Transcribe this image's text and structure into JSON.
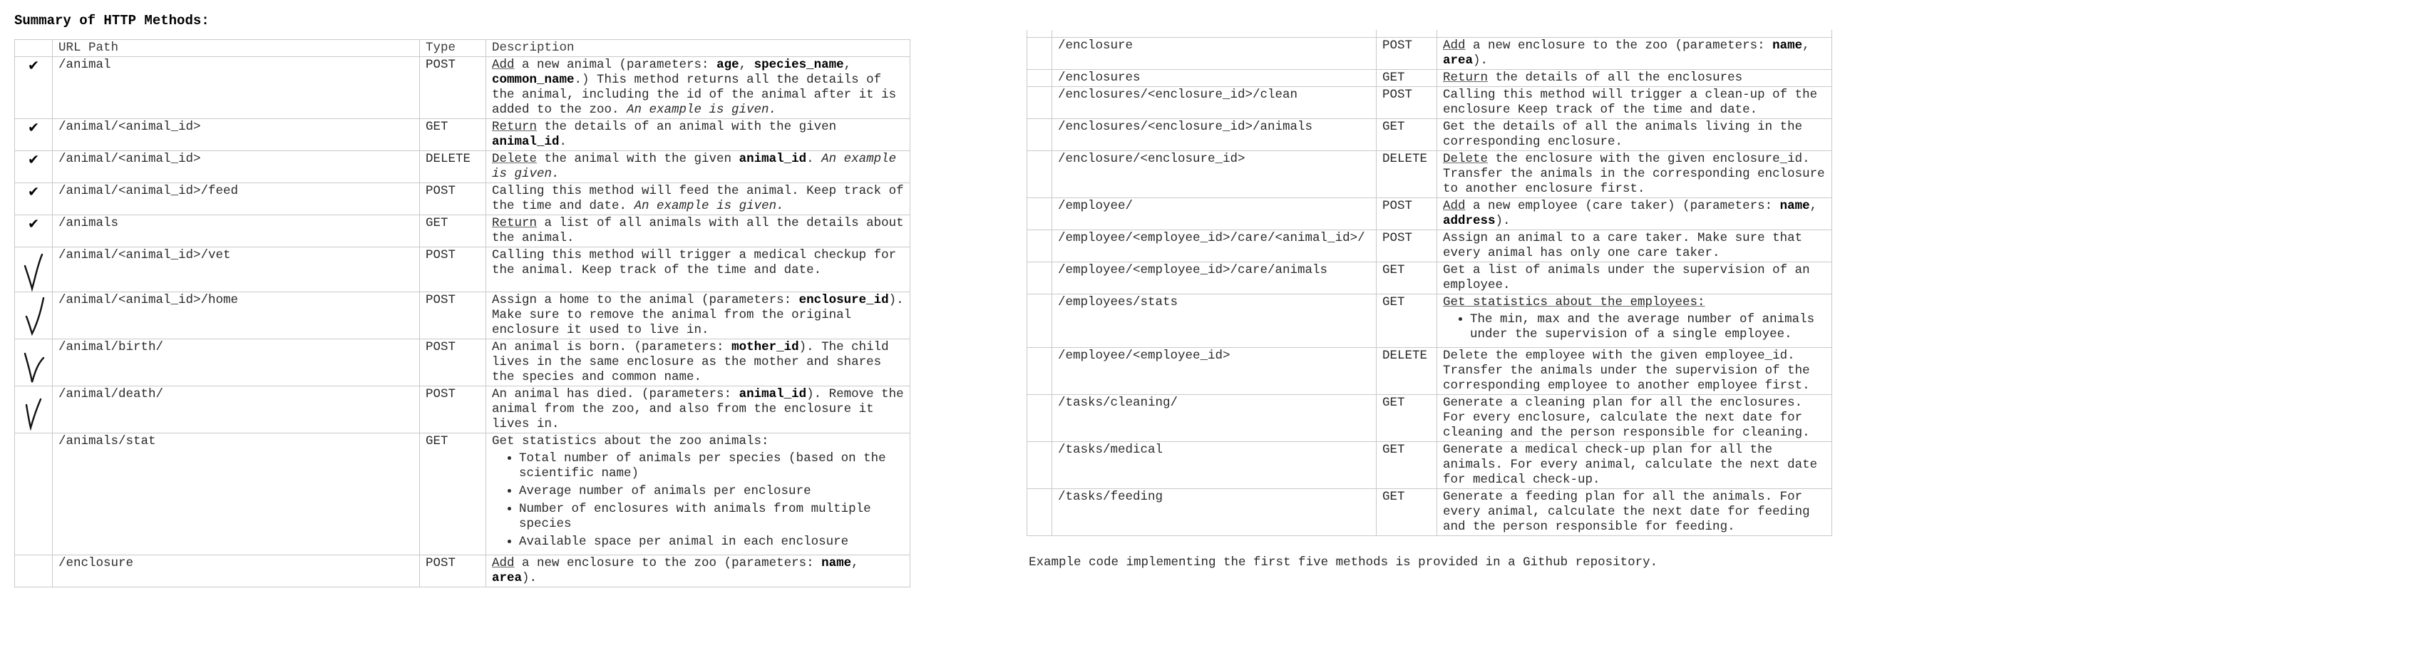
{
  "heading": "Summary of HTTP Methods:",
  "columns": {
    "url": "URL Path",
    "type": "Type",
    "description": "Description"
  },
  "left_rows": [
    {
      "url": "/animal",
      "type": "POST",
      "d": [
        {
          "t": "Add",
          "s": "u"
        },
        {
          "t": " a new animal (parameters: "
        },
        {
          "t": "age",
          "s": "b"
        },
        {
          "t": ", "
        },
        {
          "t": "species_name",
          "s": "b"
        },
        {
          "t": ", "
        },
        {
          "t": "common_name",
          "s": "b"
        },
        {
          "t": ".) This method returns all the details of the animal, including the id of the animal after it is added to the zoo. "
        },
        {
          "t": "An example is given.",
          "s": "i"
        }
      ]
    },
    {
      "url": "/animal/<animal_id>",
      "type": "GET",
      "d": [
        {
          "t": "Return",
          "s": "u"
        },
        {
          "t": " the details of an animal with the given "
        },
        {
          "t": "animal_id",
          "s": "b"
        },
        {
          "t": "."
        }
      ]
    },
    {
      "url": "/animal/<animal_id>",
      "type": "DELETE",
      "d": [
        {
          "t": "Delete",
          "s": "u"
        },
        {
          "t": " the animal with the given "
        },
        {
          "t": "animal_id",
          "s": "b"
        },
        {
          "t": ". "
        },
        {
          "t": "An example is given.",
          "s": "i"
        }
      ]
    },
    {
      "url": "/animal/<animal_id>/feed",
      "type": "POST",
      "d": [
        {
          "t": "Calling this method will feed the animal. Keep track of the time and date. "
        },
        {
          "t": "An example is given.",
          "s": "i"
        }
      ]
    },
    {
      "url": "/animals",
      "type": "GET",
      "d": [
        {
          "t": "Return",
          "s": "u"
        },
        {
          "t": " a list of all animals with all the details about the animal."
        }
      ]
    },
    {
      "url": "/animal/<animal_id>/vet",
      "type": "POST",
      "d": [
        {
          "t": "Calling this method will trigger a medical checkup for the animal. Keep track of the time and date."
        }
      ]
    },
    {
      "url": "/animal/<animal_id>/home",
      "type": "POST",
      "d": [
        {
          "t": "Assign a home to the animal (parameters: "
        },
        {
          "t": "enclosure_id",
          "s": "b"
        },
        {
          "t": "). Make sure to remove the animal from the original enclosure it used to live in."
        }
      ]
    },
    {
      "url": "/animal/birth/",
      "type": "POST",
      "d": [
        {
          "t": "An animal is born. (parameters: "
        },
        {
          "t": "mother_id",
          "s": "b"
        },
        {
          "t": "). The child lives in the same enclosure as the mother and shares the species and common name."
        }
      ]
    },
    {
      "url": "/animal/death/",
      "type": "POST",
      "d": [
        {
          "t": "An animal has died. (parameters: "
        },
        {
          "t": "animal_id",
          "s": "b"
        },
        {
          "t": "). Remove the animal from the zoo, and also from the enclosure it lives in."
        }
      ]
    },
    {
      "url": "/animals/stat",
      "type": "GET",
      "d": [
        {
          "t": "Get statistics about the zoo animals:"
        }
      ],
      "bullets": [
        "Total number of animals per species (based on the scientific name)",
        "Average number of animals per enclosure",
        "Number of enclosures with animals from multiple species",
        "Available space per animal in each enclosure"
      ]
    },
    {
      "url": "/enclosure",
      "type": "POST",
      "d": [
        {
          "t": "Add",
          "s": "u"
        },
        {
          "t": " a new enclosure to the zoo (parameters: "
        },
        {
          "t": "name",
          "s": "b"
        },
        {
          "t": ", "
        },
        {
          "t": "area",
          "s": "b"
        },
        {
          "t": ")."
        }
      ]
    }
  ],
  "marks": [
    "check",
    "check",
    "check",
    "check",
    "check",
    "hand",
    "hand",
    "hand",
    "hand",
    "",
    ""
  ],
  "right_rows": [
    {
      "url": "/enclosure",
      "type": "POST",
      "d": [
        {
          "t": "Add",
          "s": "u"
        },
        {
          "t": " a new enclosure to the zoo (parameters: "
        },
        {
          "t": "name",
          "s": "b"
        },
        {
          "t": ", "
        },
        {
          "t": "area",
          "s": "b"
        },
        {
          "t": ")."
        }
      ]
    },
    {
      "url": "/enclosures",
      "type": "GET",
      "d": [
        {
          "t": "Return",
          "s": "u"
        },
        {
          "t": " the details of all the enclosures"
        }
      ]
    },
    {
      "url": "/enclosures/<enclosure_id>/clean",
      "type": "POST",
      "d": [
        {
          "t": "Calling this method will trigger a clean-up of the enclosure Keep track of the time and date."
        }
      ]
    },
    {
      "url": "/enclosures/<enclosure_id>/animals",
      "type": "GET",
      "d": [
        {
          "t": "Get the details of all the animals living in the corresponding enclosure."
        }
      ]
    },
    {
      "url": "/enclosure/<enclosure_id>",
      "type": "DELETE",
      "d": [
        {
          "t": "Delete",
          "s": "u"
        },
        {
          "t": " the enclosure with the given enclosure_id. Transfer the animals in the corresponding enclosure to another enclosure first."
        }
      ]
    },
    {
      "url": "/employee/",
      "type": "POST",
      "d": [
        {
          "t": "Add",
          "s": "u"
        },
        {
          "t": " a new employee (care taker) (parameters: "
        },
        {
          "t": "name",
          "s": "b"
        },
        {
          "t": ", "
        },
        {
          "t": "address",
          "s": "b"
        },
        {
          "t": ")."
        }
      ]
    },
    {
      "url": "/employee/<employee_id>/care/<animal_id>/",
      "type": "POST",
      "d": [
        {
          "t": "Assign an animal to a care taker. Make sure that every animal has only one care taker."
        }
      ]
    },
    {
      "url": "/employee/<employee_id>/care/animals",
      "type": "GET",
      "d": [
        {
          "t": "Get a list of animals under the supervision of an employee."
        }
      ]
    },
    {
      "url": "/employees/stats",
      "type": "GET",
      "d": [
        {
          "t": "Get statistics about the employees:",
          "s": "u"
        }
      ],
      "bullets": [
        "The min, max and the average number of animals under the supervision of a single employee."
      ]
    },
    {
      "url": "/employee/<employee_id>",
      "type": "DELETE",
      "d": [
        {
          "t": "Delete the employee with the given employee_id. Transfer the animals under the supervision of the corresponding employee to another employee first."
        }
      ]
    },
    {
      "url": "/tasks/cleaning/",
      "type": "GET",
      "d": [
        {
          "t": "Generate a cleaning plan for all the enclosures. For every enclosure, calculate the next date for cleaning and the person responsible for cleaning."
        }
      ]
    },
    {
      "url": "/tasks/medical",
      "type": "GET",
      "d": [
        {
          "t": "Generate a medical check-up plan for all the animals. For every animal, calculate the next date for medical check-up."
        }
      ]
    },
    {
      "url": "/tasks/feeding",
      "type": "GET",
      "d": [
        {
          "t": "Generate a feeding plan for all the animals. For every animal, calculate the next date for feeding and the person responsible for feeding."
        }
      ]
    }
  ],
  "footnote": "Example code implementing the first five methods is provided in a Github repository."
}
